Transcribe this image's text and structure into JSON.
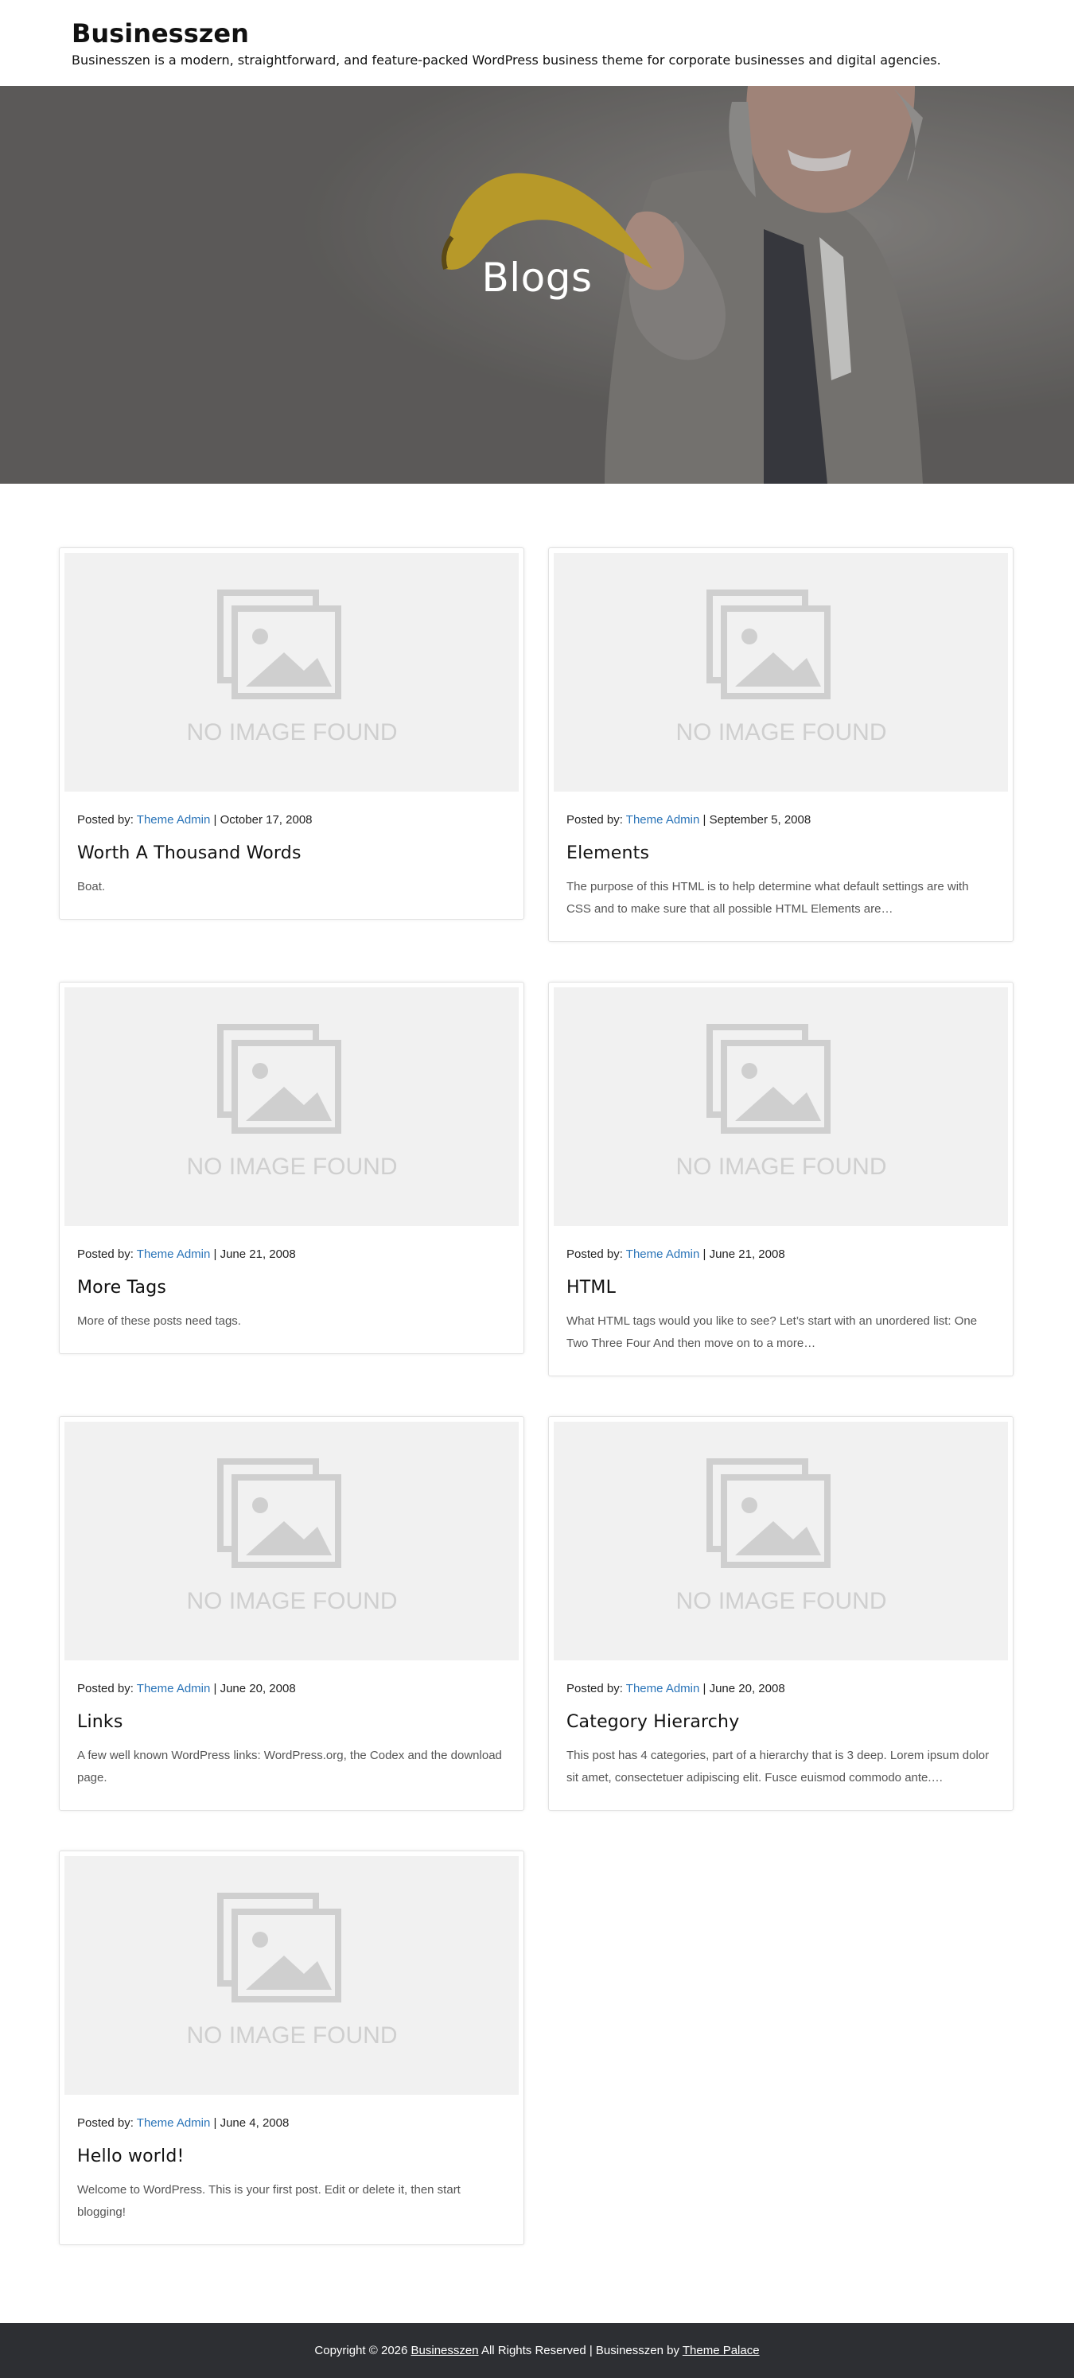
{
  "site": {
    "title": "Businesszen",
    "description": "Businesszen is a modern, straightforward, and feature-packed WordPress business theme for corporate businesses and digital agencies."
  },
  "hero": {
    "title": "Blogs"
  },
  "placeholder_text": "NO IMAGE FOUND",
  "posts": [
    {
      "posted_by_label": "Posted by:",
      "author": "Theme Admin",
      "separator": "|",
      "date": "October 17, 2008",
      "title": "Worth A Thousand Words",
      "excerpt": "Boat."
    },
    {
      "posted_by_label": "Posted by:",
      "author": "Theme Admin",
      "separator": "|",
      "date": "September 5, 2008",
      "title": "Elements",
      "excerpt": "The purpose of this HTML is to help determine what default settings are with CSS and to make sure that all possible HTML Elements are…"
    },
    {
      "posted_by_label": "Posted by:",
      "author": "Theme Admin",
      "separator": "|",
      "date": "June 21, 2008",
      "title": "More Tags",
      "excerpt": "More of these posts need tags."
    },
    {
      "posted_by_label": "Posted by:",
      "author": "Theme Admin",
      "separator": "|",
      "date": "June 21, 2008",
      "title": "HTML",
      "excerpt": "What HTML tags would you like to see? Let’s start with an unordered list: One Two Three Four And then move on to a more…"
    },
    {
      "posted_by_label": "Posted by:",
      "author": "Theme Admin",
      "separator": "|",
      "date": "June 20, 2008",
      "title": "Links",
      "excerpt": "A few well known WordPress links: WordPress.org, the Codex and the download page."
    },
    {
      "posted_by_label": "Posted by:",
      "author": "Theme Admin",
      "separator": "|",
      "date": "June 20, 2008",
      "title": "Category Hierarchy",
      "excerpt": "This post has 4 categories, part of a hierarchy that is 3 deep. Lorem ipsum dolor sit amet, consectetuer adipiscing elit. Fusce euismod commodo ante.…"
    },
    {
      "posted_by_label": "Posted by:",
      "author": "Theme Admin",
      "separator": "|",
      "date": "June 4, 2008",
      "title": "Hello world!",
      "excerpt": "Welcome to WordPress. This is your first post. Edit or delete it, then start blogging!"
    }
  ],
  "footer": {
    "copyright_prefix": "Copyright © 2026",
    "site_link": "Businesszen",
    "rights": "All Rights Reserved | Businesszen by",
    "theme_link": "Theme Palace"
  }
}
